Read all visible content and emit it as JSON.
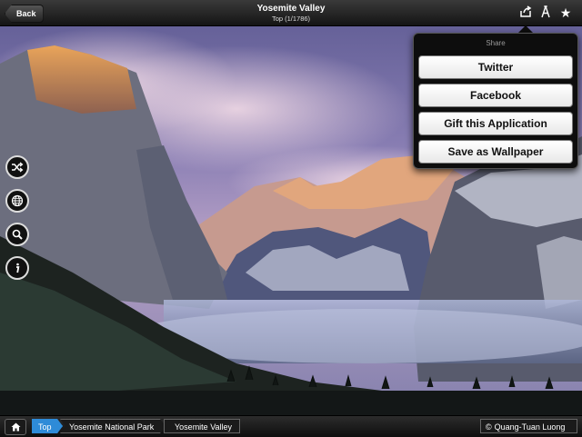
{
  "header": {
    "back_label": "Back",
    "title": "Yosemite Valley",
    "subtitle": "Top (1/1786)",
    "icons": [
      "share-icon",
      "font-size-icon",
      "favorite-star-icon"
    ]
  },
  "share_menu": {
    "heading": "Share",
    "options": [
      "Twitter",
      "Facebook",
      "Gift this Application",
      "Save as Wallpaper"
    ]
  },
  "side_tools": [
    "shuffle-icon",
    "globe-icon",
    "search-icon",
    "info-icon"
  ],
  "breadcrumb": {
    "home_icon": "home-icon",
    "items": [
      "Top",
      "Yosemite National Park",
      "Yosemite Valley"
    ]
  },
  "credit": {
    "symbol": "©",
    "name": "Quang-Tuan Luong"
  },
  "colors": {
    "accent_blue": "#2e8bd8",
    "bar_dark": "#141414"
  }
}
